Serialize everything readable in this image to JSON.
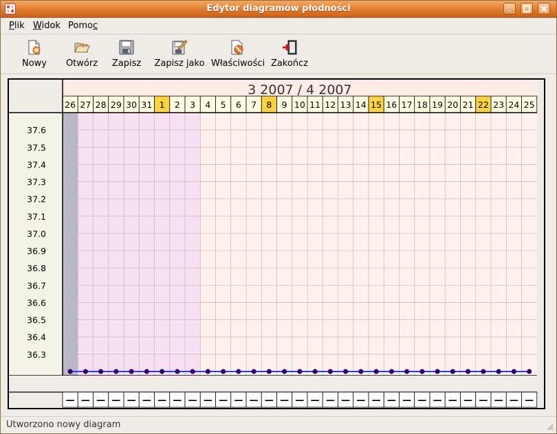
{
  "window": {
    "title": "Edytor diagramów płodności",
    "buttons": [
      "minimize",
      "maximize",
      "close"
    ]
  },
  "menu": [
    {
      "label": "Plik",
      "accel": "P",
      "rest": "lik"
    },
    {
      "label": "Widok",
      "accel": "W",
      "rest": "idok"
    },
    {
      "label": "Pomoc",
      "accel": "c",
      "rest": "Pomo"
    }
  ],
  "toolbar": [
    {
      "id": "new",
      "label": "Nowy",
      "icon": "new-document-icon"
    },
    {
      "id": "open",
      "label": "Otwórz",
      "icon": "folder-open-icon"
    },
    {
      "id": "save",
      "label": "Zapisz",
      "icon": "floppy-disk-icon"
    },
    {
      "id": "save-as",
      "label": "Zapisz jako",
      "icon": "save-as-icon"
    },
    {
      "id": "properties",
      "label": "Właściwości",
      "icon": "properties-icon"
    },
    {
      "id": "quit",
      "label": "Zakończ",
      "icon": "exit-icon"
    }
  ],
  "chart_data": {
    "type": "line",
    "title": "3 2007 / 4 2007",
    "x": [
      "26",
      "27",
      "28",
      "29",
      "30",
      "31",
      "1",
      "2",
      "3",
      "4",
      "5",
      "6",
      "7",
      "8",
      "9",
      "10",
      "11",
      "12",
      "13",
      "14",
      "15",
      "16",
      "17",
      "18",
      "19",
      "20",
      "21",
      "22",
      "23",
      "24",
      "25"
    ],
    "highlighted_days": [
      "1",
      "8",
      "15",
      "22"
    ],
    "y_ticks": [
      37.6,
      37.5,
      37.4,
      37.3,
      37.2,
      37.1,
      37.0,
      36.9,
      36.8,
      36.7,
      36.6,
      36.5,
      36.4,
      36.3
    ],
    "y_labels": [
      "37.6",
      "37.5",
      "37.4",
      "37.3",
      "37.2",
      "37.1",
      "37.0",
      "36.9",
      "36.8",
      "36.7",
      "36.6",
      "36.5",
      "36.4",
      "36.3"
    ],
    "series": [
      {
        "values": [
          36.2,
          36.2,
          36.2,
          36.2,
          36.2,
          36.2,
          36.2,
          36.2,
          36.2,
          36.2,
          36.2,
          36.2,
          36.2,
          36.2,
          36.2,
          36.2,
          36.2,
          36.2,
          36.2,
          36.2,
          36.2,
          36.2,
          36.2,
          36.2,
          36.2,
          36.2,
          36.2,
          36.2,
          36.2,
          36.2,
          36.2
        ]
      }
    ],
    "row_markers": [
      "—",
      "—",
      "—",
      "—",
      "—",
      "—",
      "—",
      "—",
      "—",
      "—",
      "—",
      "—",
      "—",
      "—",
      "—",
      "—",
      "—",
      "—",
      "—",
      "—",
      "—",
      "—",
      "—",
      "—",
      "—",
      "—",
      "—",
      "—",
      "—",
      "—",
      "—"
    ],
    "colors": {
      "header_bg": "#fdece6",
      "day_cell_bg": "#ffffe4",
      "day_highlight": "#fcd23f",
      "plot_bg": "#fff1ee",
      "period_bg": "#f7e0f2",
      "first_col_bg": "#b8b8c8",
      "axis_panel_bg": "#f4f4e8",
      "line": "#1c3ff0",
      "point": "#30006b",
      "grid": "#c9b2b0"
    }
  },
  "status": {
    "text": "Utworzono nowy diagram"
  }
}
